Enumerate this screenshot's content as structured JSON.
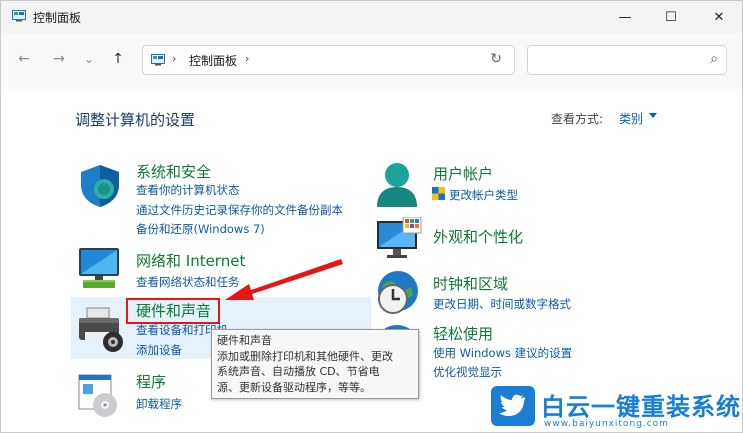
{
  "window": {
    "title": "控制面板",
    "minimize_glyph": "—",
    "maximize_glyph": "☐",
    "close_glyph": "✕"
  },
  "nav": {
    "back_glyph": "←",
    "forward_glyph": "→",
    "dropdown_glyph": "⌄",
    "up_glyph": "↑",
    "breadcrumb": "控制面板",
    "sep": "›",
    "refresh_glyph": "↻",
    "search_glyph": "⌕",
    "search_placeholder": ""
  },
  "main": {
    "heading": "调整计算机的设置",
    "view_by_label": "查看方式:",
    "view_by_value": "类别"
  },
  "categories_left": [
    {
      "title": "系统和安全",
      "icon": "shield-icon",
      "links": [
        "查看你的计算机状态",
        "通过文件历史记录保存你的文件备份副本",
        "备份和还原(Windows 7)"
      ]
    },
    {
      "title": "网络和 Internet",
      "icon": "network-icon",
      "links": [
        "查看网络状态和任务"
      ]
    },
    {
      "title": "硬件和声音",
      "icon": "printer-icon",
      "links": [
        "查看设备和打印机",
        "添加设备"
      ]
    },
    {
      "title": "程序",
      "icon": "programs-icon",
      "links": [
        "卸载程序"
      ]
    }
  ],
  "categories_right": [
    {
      "title": "用户帐户",
      "icon": "user-icon",
      "links": [
        "更改帐户类型"
      ]
    },
    {
      "title": "外观和个性化",
      "icon": "monitor-icon",
      "links": []
    },
    {
      "title": "时钟和区域",
      "icon": "clock-icon",
      "links": [
        "更改日期、时间或数字格式"
      ]
    },
    {
      "title": "轻松使用",
      "icon": "accessibility-icon",
      "links": [
        "使用 Windows 建议的设置",
        "优化视觉显示"
      ]
    }
  ],
  "tooltip": {
    "lines": [
      "硬件和声音",
      "添加或删除打印机和其他硬件、更改",
      "系统声音、自动播放 CD、节省电",
      "源、更新设备驱动程序，等等。"
    ]
  },
  "watermark": {
    "text": "白云一键重装系统",
    "url": "www.baiyunxitong.com"
  },
  "colors": {
    "title_green": "#0e7a37",
    "link_blue": "#0e5aa7",
    "highlight_red": "#e81515"
  }
}
